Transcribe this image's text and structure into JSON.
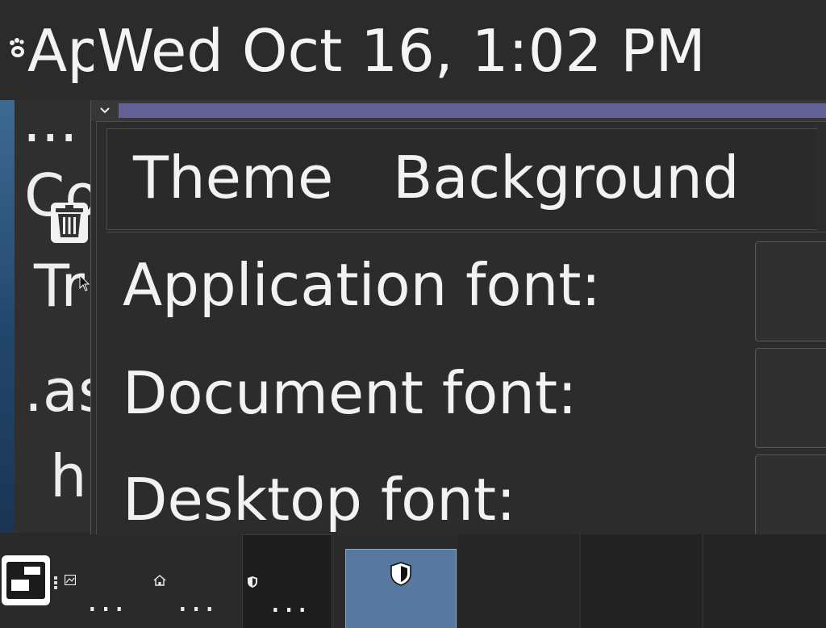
{
  "top_panel": {
    "apps_label": "Applications",
    "clock": "Wed Oct 16,  1:02 PM",
    "icons": [
      "gnome-foot-icon"
    ]
  },
  "desktop_menu": {
    "items": [
      "...",
      "Co",
      "Tr",
      ".as",
      "h"
    ]
  },
  "window": {
    "menu_icon": "chevron-down-icon",
    "accent_color": "#646196",
    "tabs": [
      "Theme",
      "Background"
    ],
    "fonts": [
      {
        "label": "Application font:"
      },
      {
        "label": "Document font:"
      },
      {
        "label": "Desktop font:"
      }
    ]
  },
  "taskbar": {
    "tasks": [
      {
        "icon": "image-icon",
        "label": "..."
      },
      {
        "icon": "home-icon",
        "label": "..."
      },
      {
        "icon": "shield-icon",
        "label": "..."
      },
      {
        "icon": "shield-icon",
        "label": ""
      }
    ],
    "active_color": "#58799f"
  }
}
